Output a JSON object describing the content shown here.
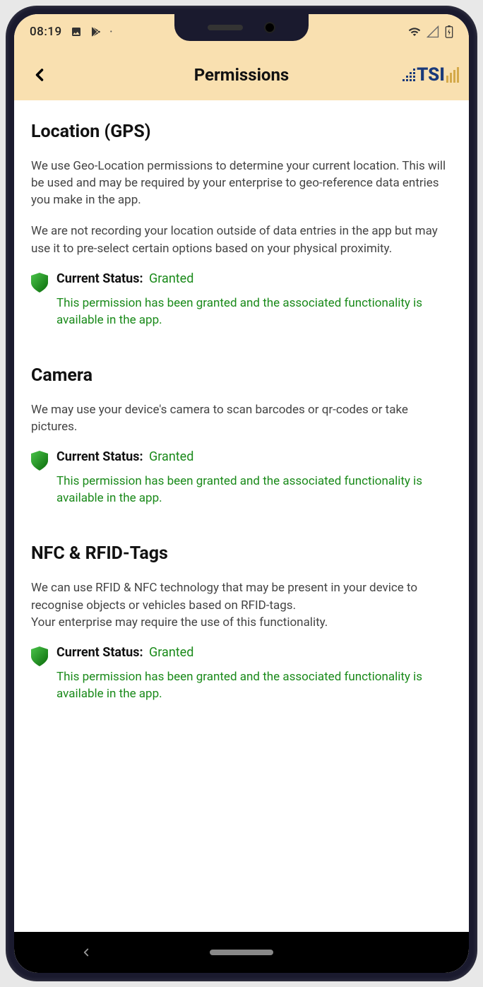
{
  "status_bar": {
    "time": "08:19"
  },
  "header": {
    "title": "Permissions",
    "logo_text": "TSI"
  },
  "sections": [
    {
      "title": "Location (GPS)",
      "desc1": "We use Geo-Location permissions to determine your current location. This will be used and may be required by your enterprise to geo-reference data entries you make in the app.",
      "desc2": "We are not recording your location outside of data entries in the app but may use it to pre-select certain options based on your physical proximity.",
      "status_label": "Current Status:",
      "status_value": "Granted",
      "status_detail": "This permission has been granted and the associated functionality is available in the app."
    },
    {
      "title": "Camera",
      "desc1": "We may use your device's camera to scan barcodes or qr-codes or take pictures.",
      "status_label": "Current Status:",
      "status_value": "Granted",
      "status_detail": "This permission has been granted and the associated functionality is available in the app."
    },
    {
      "title": "NFC & RFID-Tags",
      "desc1": "We can use RFID & NFC technology that may be present in your device to recognise objects or vehicles based on RFID-tags.\nYour enterprise may require the use of this functionality.",
      "status_label": "Current Status:",
      "status_value": "Granted",
      "status_detail": "This permission has been granted and the associated functionality is available in the app."
    }
  ]
}
